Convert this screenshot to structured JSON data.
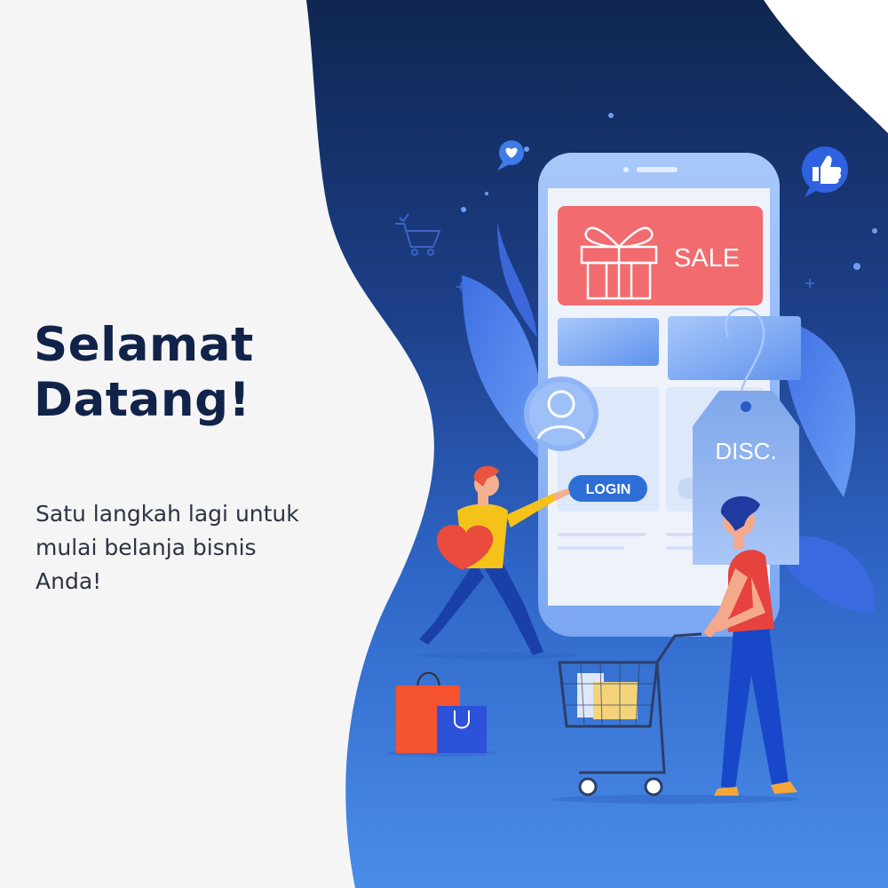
{
  "heading": {
    "line1": "Selamat",
    "line2": "Datang!"
  },
  "subheading": {
    "line1": "Satu langkah lagi untuk",
    "line2": "mulai belanja bisnis",
    "line3": "Anda!"
  },
  "illustration": {
    "sale_label": "SALE",
    "login_label": "LOGIN",
    "discount_label": "DISC."
  },
  "colors": {
    "navy": "#0f2650",
    "blue": "#3f7fe0",
    "heading": "#12234a",
    "sale": "#f26b6f"
  },
  "icons": [
    "heart-chat-icon",
    "thumbs-up-icon",
    "shopping-cart-icon",
    "user-icon"
  ]
}
